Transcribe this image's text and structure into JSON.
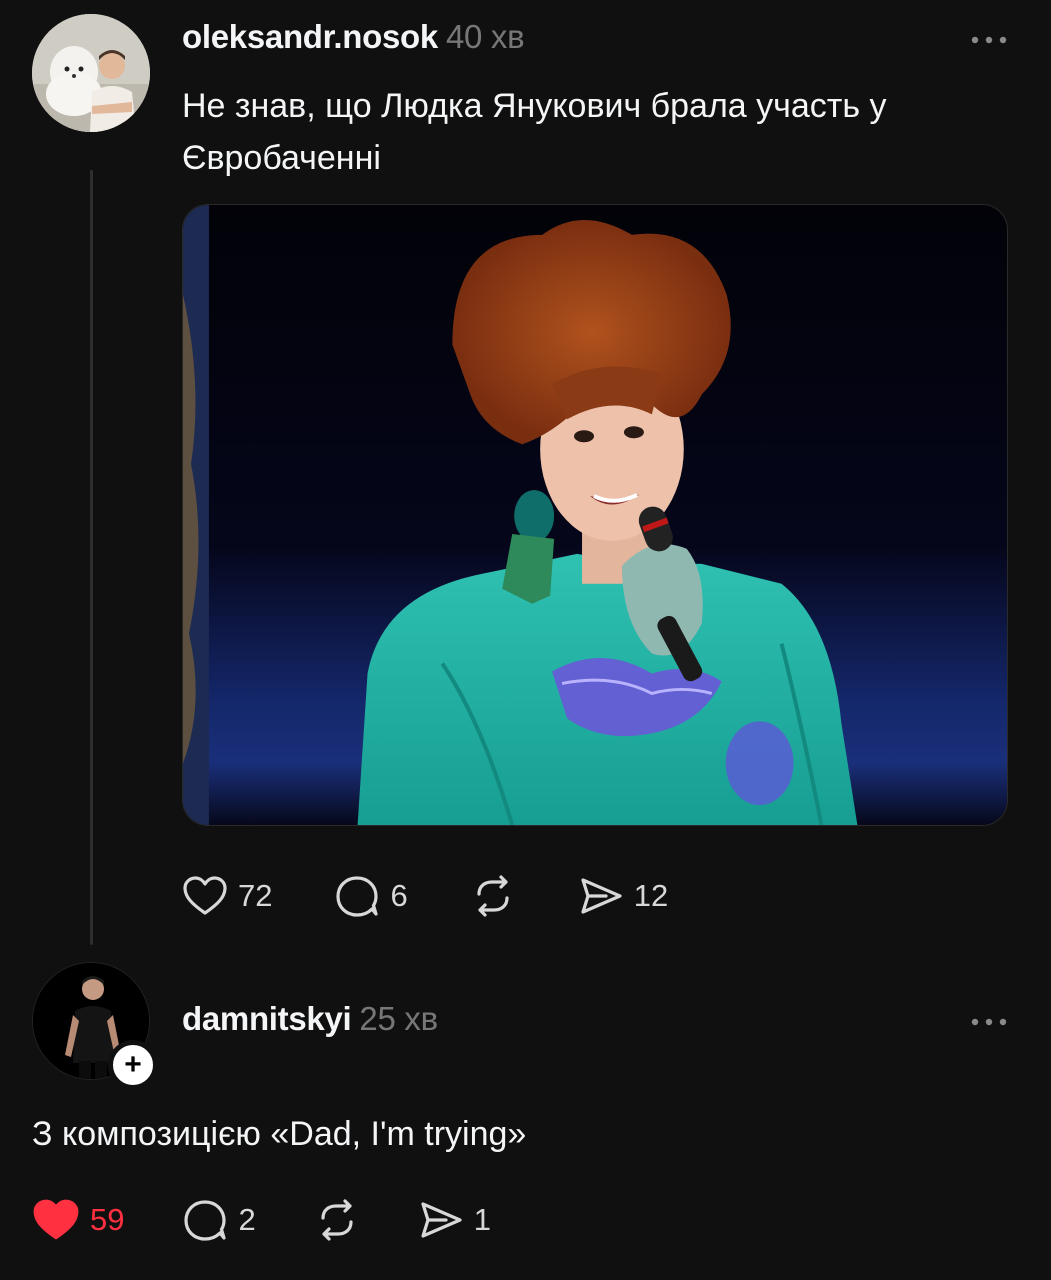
{
  "post1": {
    "username": "oleksandr.nosok",
    "time": "40 хв",
    "more_icon": "…",
    "text": "Не знав, що Людка Янукович брала участь у Євробаченні",
    "actions": {
      "like_count": "72",
      "comment_count": "6",
      "share_count": "12"
    }
  },
  "post2": {
    "username": "damnitskyi",
    "time": "25 хв",
    "more_icon": "…",
    "follow_symbol": "+",
    "text": "З композицією «Dad, I'm trying»",
    "actions": {
      "like_count": "59",
      "comment_count": "2",
      "share_count": "1",
      "liked": true
    }
  },
  "colors": {
    "background": "#101010",
    "liked": "#ff3040",
    "muted": "#777777"
  },
  "icons": [
    "heart-icon",
    "comment-icon",
    "repost-icon",
    "send-icon",
    "more-icon",
    "plus-icon"
  ]
}
